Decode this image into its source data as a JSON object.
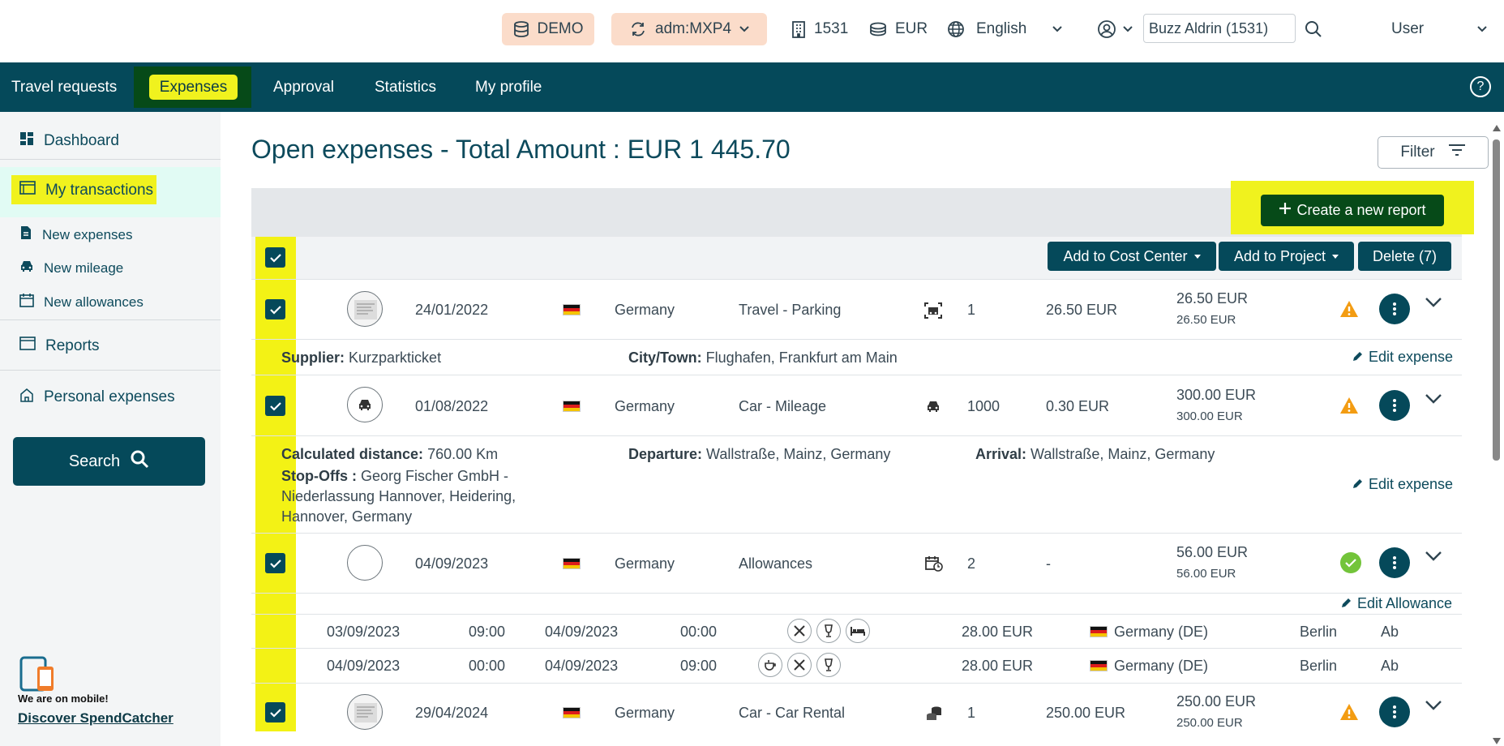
{
  "topbar": {
    "env_label": "DEMO",
    "company_label": "adm:MXP4",
    "entity_code": "1531",
    "currency": "EUR",
    "language": "English",
    "user_search_value": "Buzz Aldrin (1531)",
    "user_menu_label": "User"
  },
  "nav": {
    "items": [
      "Travel requests",
      "Expenses",
      "Approval",
      "Statistics",
      "My profile"
    ],
    "help": "?"
  },
  "sidebar": {
    "dashboard": "Dashboard",
    "my_transactions": "My transactions",
    "new_expenses": "New expenses",
    "new_mileage": "New mileage",
    "new_allowances": "New allowances",
    "reports": "Reports",
    "personal_expenses": "Personal expenses",
    "search_button": "Search",
    "mobile_text": "We are on mobile!",
    "mobile_link": "Discover SpendCatcher"
  },
  "main": {
    "title": "Open expenses - Total Amount : EUR 1 445.70",
    "filter_label": "Filter",
    "create_report_label": "Create a new report",
    "add_cost_center_label": "Add to Cost Center",
    "add_project_label": "Add to Project",
    "delete_label": "Delete (7)",
    "edit_expense_label": "Edit expense",
    "edit_allowance_label": "Edit Allowance"
  },
  "rows": [
    {
      "date": "24/01/2022",
      "country": "Germany",
      "category": "Travel - Parking",
      "qty": "1",
      "unit": "26.50 EUR",
      "total": "26.50 EUR",
      "total_sub": "26.50 EUR",
      "status": "warning",
      "details": [
        {
          "label": "Supplier:",
          "value": "Kurzparkticket"
        },
        {
          "label": "City/Town:",
          "value": "Flughafen, Frankfurt am Main"
        }
      ]
    },
    {
      "date": "01/08/2022",
      "country": "Germany",
      "category": "Car - Mileage",
      "qty": "1000",
      "unit": "0.30 EUR",
      "total": "300.00 EUR",
      "total_sub": "300.00 EUR",
      "status": "warning",
      "details": [
        {
          "label": "Calculated distance:",
          "value": "760.00 Km"
        },
        {
          "label": "Stop-Offs :",
          "value": "Georg Fischer GmbH -"
        },
        {
          "label": "",
          "value": "Niederlassung Hannover, Heidering,"
        },
        {
          "label": "",
          "value": "Hannover, Germany"
        },
        {
          "label": "Departure:",
          "value": "Wallstraße, Mainz, Germany"
        },
        {
          "label": "Arrival:",
          "value": "Wallstraße, Mainz, Germany"
        }
      ]
    },
    {
      "date": "04/09/2023",
      "country": "Germany",
      "category": "Allowances",
      "qty": "2",
      "unit": "-",
      "total": "56.00 EUR",
      "total_sub": "56.00 EUR",
      "status": "ok",
      "allowances": [
        {
          "from_date": "03/09/2023",
          "from_time": "09:00",
          "to_date": "04/09/2023",
          "to_time": "00:00",
          "amount": "28.00 EUR",
          "country": "Germany (DE)",
          "city": "Berlin",
          "extra": "Ab"
        },
        {
          "from_date": "04/09/2023",
          "from_time": "00:00",
          "to_date": "04/09/2023",
          "to_time": "09:00",
          "amount": "28.00 EUR",
          "country": "Germany (DE)",
          "city": "Berlin",
          "extra": "Ab"
        }
      ]
    },
    {
      "date": "29/04/2024",
      "country": "Germany",
      "category": "Car - Car Rental",
      "qty": "1",
      "unit": "250.00 EUR",
      "total": "250.00 EUR",
      "total_sub": "250.00 EUR",
      "status": "warning"
    }
  ],
  "colors": {
    "primary": "#05495a",
    "highlight": "#f0f21e",
    "create_button": "#064a18",
    "warning": "#f39c12",
    "ok": "#73c43a"
  }
}
